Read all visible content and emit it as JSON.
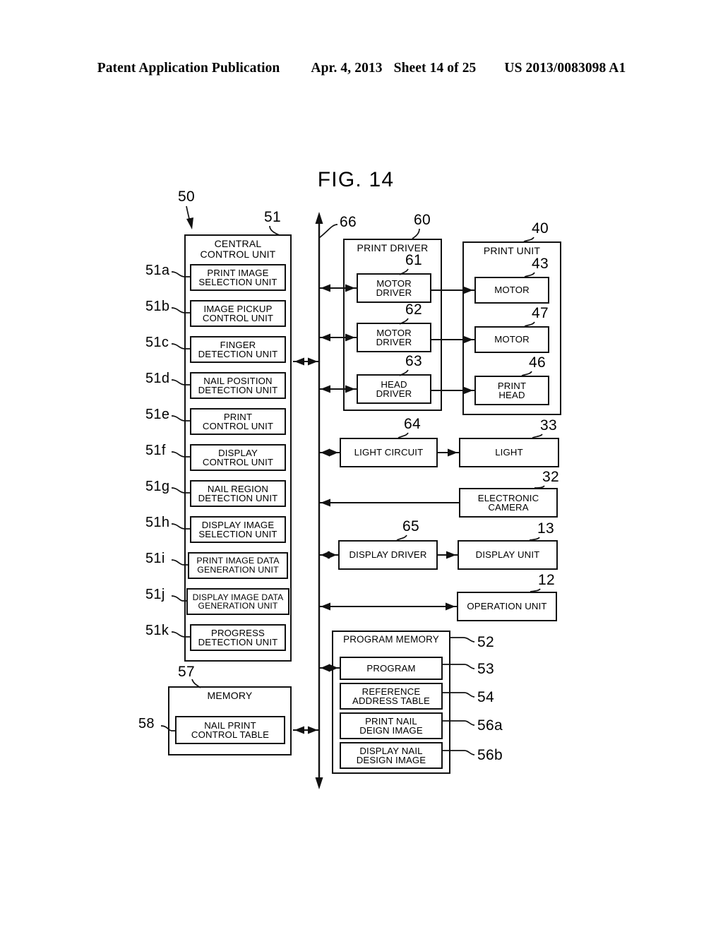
{
  "header": {
    "publication": "Patent Application Publication",
    "date": "Apr. 4, 2013",
    "sheet": "Sheet 14 of 25",
    "number": "US 2013/0083098 A1"
  },
  "figure": {
    "title": "FIG. 14"
  },
  "refs": {
    "system": "50",
    "ccu": "51",
    "ccu_a": "51a",
    "ccu_b": "51b",
    "ccu_c": "51c",
    "ccu_d": "51d",
    "ccu_e": "51e",
    "ccu_f": "51f",
    "ccu_g": "51g",
    "ccu_h": "51h",
    "ccu_i": "51i",
    "ccu_j": "51j",
    "ccu_k": "51k",
    "memory": "57",
    "nail_print_control_table": "58",
    "bus": "66",
    "print_driver": "60",
    "motor_driver_1": "61",
    "motor_driver_2": "62",
    "head_driver": "63",
    "light_circuit": "64",
    "display_driver": "65",
    "print_unit": "40",
    "motor_1": "43",
    "motor_2": "47",
    "print_head": "46",
    "light": "33",
    "electronic_camera": "32",
    "display_unit": "13",
    "operation_unit": "12",
    "program_memory": "52",
    "program": "53",
    "reference_address_table": "54",
    "print_nail_design_image": "56a",
    "display_nail_design_image": "56b"
  },
  "blocks": {
    "central_control_unit": {
      "title": "CENTRAL CONTROL UNIT",
      "line1": "CENTRAL",
      "line2": "CONTROL UNIT"
    },
    "ccu_children": [
      {
        "id": "print-image-selection-unit",
        "line1": "PRINT IMAGE",
        "line2": "SELECTION UNIT",
        "ref": "51a"
      },
      {
        "id": "image-pickup-control-unit",
        "line1": "IMAGE PICKUP",
        "line2": "CONTROL UNIT",
        "ref": "51b"
      },
      {
        "id": "finger-detection-unit",
        "line1": "FINGER",
        "line2": "DETECTION UNIT",
        "ref": "51c"
      },
      {
        "id": "nail-position-detection-unit",
        "line1": "NAIL POSITION",
        "line2": "DETECTION UNIT",
        "ref": "51d"
      },
      {
        "id": "print-control-unit",
        "line1": "PRINT",
        "line2": "CONTROL UNIT",
        "ref": "51e"
      },
      {
        "id": "display-control-unit",
        "line1": "DISPLAY",
        "line2": "CONTROL UNIT",
        "ref": "51f"
      },
      {
        "id": "nail-region-detection-unit",
        "line1": "NAIL REGION",
        "line2": "DETECTION UNIT",
        "ref": "51g"
      },
      {
        "id": "display-image-selection-unit",
        "line1": "DISPLAY IMAGE",
        "line2": "SELECTION UNIT",
        "ref": "51h"
      },
      {
        "id": "print-image-data-generation-unit",
        "line1": "PRINT IMAGE DATA",
        "line2": "GENERATION UNIT",
        "ref": "51i"
      },
      {
        "id": "display-image-data-generation-unit",
        "line1": "DISPLAY IMAGE DATA",
        "line2": "GENERATION UNIT",
        "ref": "51j"
      },
      {
        "id": "progress-detection-unit",
        "line1": "PROGRESS",
        "line2": "DETECTION UNIT",
        "ref": "51k"
      }
    ],
    "memory": {
      "title": "MEMORY",
      "ref": "57"
    },
    "nail_print_control_table": {
      "line1": "NAIL PRINT",
      "line2": "CONTROL TABLE",
      "ref": "58"
    },
    "print_driver": {
      "title": "PRINT DRIVER",
      "ref": "60"
    },
    "print_driver_children": [
      {
        "id": "motor-driver-1",
        "line1": "MOTOR",
        "line2": "DRIVER",
        "ref": "61"
      },
      {
        "id": "motor-driver-2",
        "line1": "MOTOR",
        "line2": "DRIVER",
        "ref": "62"
      },
      {
        "id": "head-driver",
        "line1": "HEAD",
        "line2": "DRIVER",
        "ref": "63"
      }
    ],
    "print_unit": {
      "title": "PRINT UNIT",
      "ref": "40"
    },
    "print_unit_children": [
      {
        "id": "motor-1",
        "line1": "MOTOR",
        "line2": "",
        "ref": "43"
      },
      {
        "id": "motor-2",
        "line1": "MOTOR",
        "line2": "",
        "ref": "47"
      },
      {
        "id": "print-head",
        "line1": "PRINT",
        "line2": "HEAD",
        "ref": "46"
      }
    ],
    "light_circuit": {
      "label": "LIGHT CIRCUIT",
      "ref": "64"
    },
    "light": {
      "label": "LIGHT",
      "ref": "33"
    },
    "electronic_camera": {
      "line1": "ELECTRONIC",
      "line2": "CAMERA",
      "ref": "32"
    },
    "display_driver": {
      "label": "DISPLAY DRIVER",
      "ref": "65"
    },
    "display_unit": {
      "label": "DISPLAY UNIT",
      "ref": "13"
    },
    "operation_unit": {
      "label": "OPERATION UNIT",
      "ref": "12"
    },
    "program_memory": {
      "title": "PROGRAM MEMORY",
      "ref": "52"
    },
    "program_memory_children": [
      {
        "id": "program",
        "line1": "PROGRAM",
        "line2": "",
        "ref": "53"
      },
      {
        "id": "reference-address-table",
        "line1": "REFERENCE",
        "line2": "ADDRESS TABLE",
        "ref": "54"
      },
      {
        "id": "print-nail-design-image",
        "line1": "PRINT NAIL",
        "line2": "DEIGN IMAGE",
        "ref": "56a"
      },
      {
        "id": "display-nail-design-image",
        "line1": "DISPLAY NAIL",
        "line2": "DESIGN IMAGE",
        "ref": "56b"
      }
    ]
  }
}
